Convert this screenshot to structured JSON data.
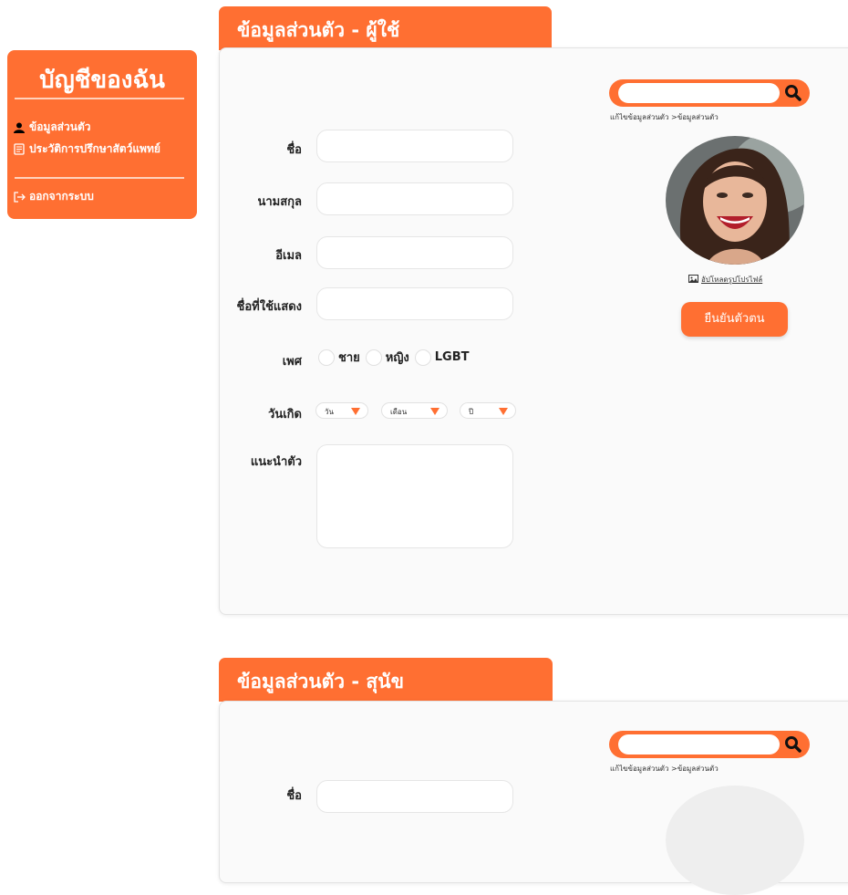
{
  "sidebar": {
    "title": "บัญชีของฉัน",
    "items": [
      {
        "label": "ข้อมูลส่วนตัว",
        "icon": "user-icon"
      },
      {
        "label": "ประวัติการปรึกษาสัตว์แพทย์",
        "icon": "document-icon"
      },
      {
        "label": "ออกจากระบบ",
        "icon": "logout-icon"
      }
    ]
  },
  "user_section": {
    "tab_title": "ข้อมูลส่วนตัว - ผู้ใช้",
    "search": {
      "placeholder": "",
      "value": ""
    },
    "breadcrumb": "แก้ไขข้อมูลส่วนตัว >ข้อมูลส่วนตัว",
    "fields": {
      "first_name": {
        "label": "ชื่อ",
        "value": ""
      },
      "last_name": {
        "label": "นามสกุล",
        "value": ""
      },
      "email": {
        "label": "อีเมล",
        "value": ""
      },
      "display_name": {
        "label": "ชื่อที่ใช้แสดง",
        "value": ""
      }
    },
    "gender": {
      "label": "เพศ",
      "options": [
        "ชาย",
        "หญิง",
        "LGBT"
      ]
    },
    "birthdate": {
      "label": "วันเกิด",
      "day": "วัน",
      "month": "เดือน",
      "year": "ปี"
    },
    "bio": {
      "label": "แนะนำตัว",
      "value": ""
    },
    "upload_label": "อัปโหลดรูปโปรไฟล์",
    "verify_button": "ยืนยันตัวตน"
  },
  "dog_section": {
    "tab_title": "ข้อมูลส่วนตัว - สุนัข",
    "search": {
      "placeholder": "",
      "value": ""
    },
    "breadcrumb": "แก้ไขข้อมูลส่วนตัว >ข้อมูลส่วนตัว",
    "fields": {
      "name": {
        "label": "ชื่อ",
        "value": ""
      }
    }
  },
  "colors": {
    "accent": "#ff6f32",
    "card_bg": "#fafafa"
  }
}
